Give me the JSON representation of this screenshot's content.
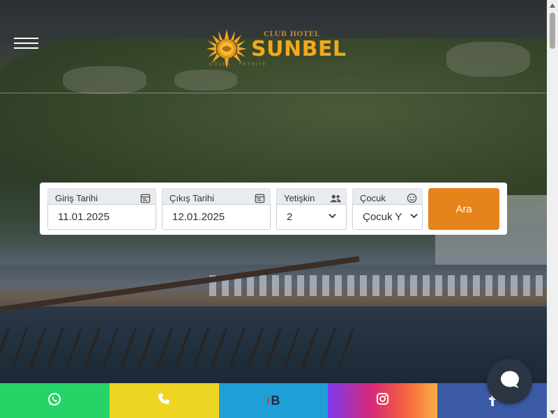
{
  "header": {
    "logo": {
      "club": "CLUB HOTEL",
      "brand": "SUNBEL",
      "sub": "GÖCEK · FETHIYE"
    }
  },
  "booking": {
    "checkin": {
      "label": "Giriş Tarihi",
      "value": "11.01.2025",
      "icon": "calendar-icon"
    },
    "checkout": {
      "label": "Çıkış Tarihi",
      "value": "12.01.2025",
      "icon": "calendar-icon"
    },
    "adults": {
      "label": "Yetişkin",
      "value": "2",
      "icon": "users-icon"
    },
    "children": {
      "label": "Çocuk",
      "value": "Çocuk Y",
      "icon": "smile-icon"
    },
    "search_label": "Ara"
  },
  "social": {
    "booking_text": "B"
  },
  "colors": {
    "accent": "#e6831a",
    "brand": "#f2a81c",
    "whatsapp": "#25d366",
    "phone": "#efd523",
    "booking": "#1f9fd6",
    "facebook": "#3b5ba5"
  }
}
